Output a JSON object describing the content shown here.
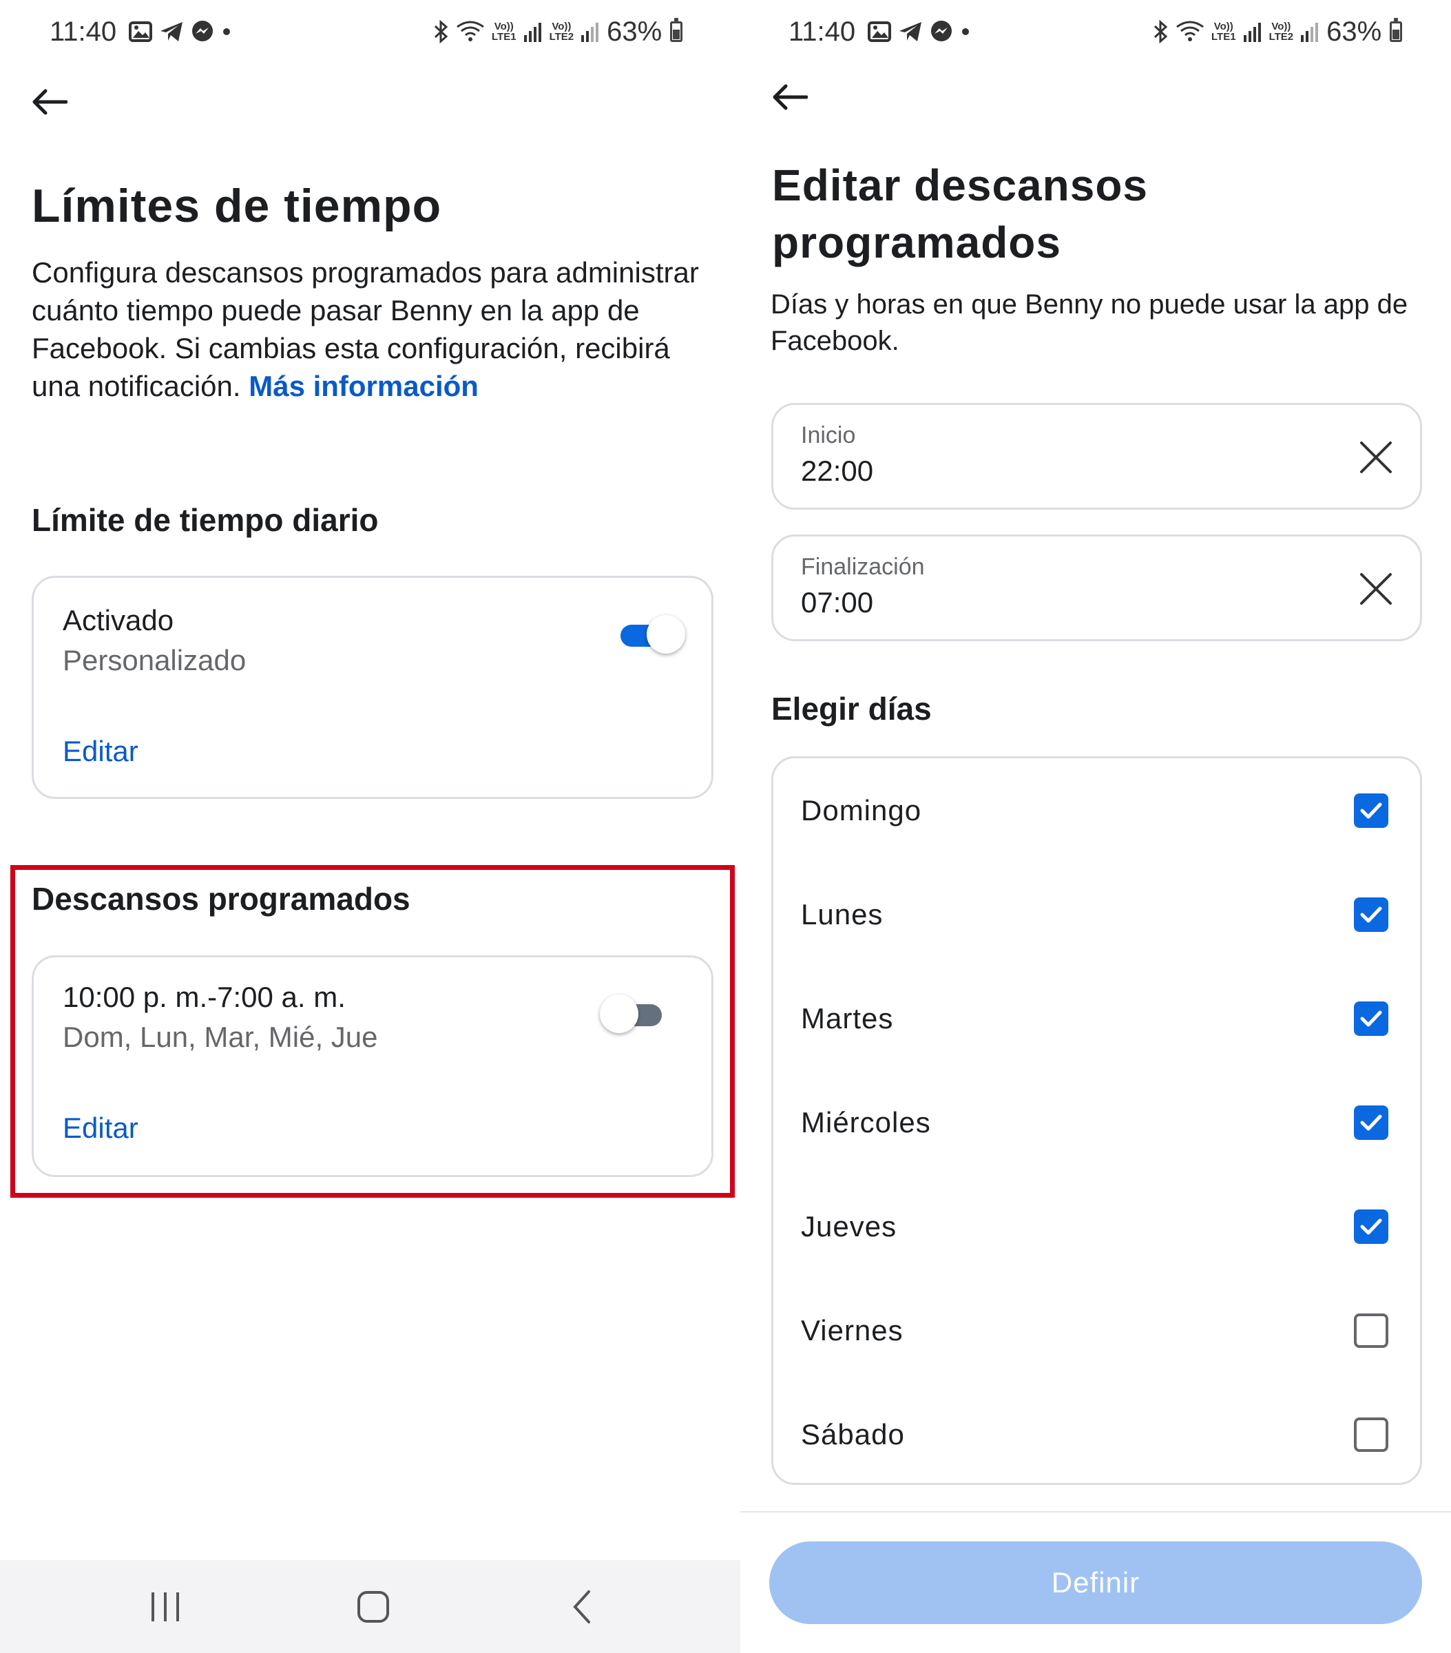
{
  "status_bar": {
    "time": "11:40",
    "battery": "63%",
    "net1": [
      "Vo))",
      "LTE1"
    ],
    "net2": [
      "Vo))",
      "LTE2"
    ],
    "icons": [
      "image-icon",
      "telegram-icon",
      "messenger-icon",
      "dot-icon",
      "bluetooth-icon",
      "wifi-icon",
      "signal-icon",
      "battery-icon"
    ]
  },
  "left": {
    "title": "Límites de tiempo",
    "description": "Configura descansos programados para administrar cuánto tiempo puede pasar Benny en la app de Facebook. Si cambias esta configuración, recibirá una notificación.",
    "more_info_link": "Más información",
    "daily_limit": {
      "heading": "Límite de tiempo diario",
      "status": "Activado",
      "mode": "Personalizado",
      "edit": "Editar",
      "enabled": true
    },
    "scheduled_breaks": {
      "heading": "Descansos programados",
      "range": "10:00 p. m.-7:00 a. m.",
      "days": "Dom, Lun, Mar, Mié, Jue",
      "edit": "Editar",
      "enabled": false
    }
  },
  "right": {
    "title_line1": "Editar descansos",
    "title_line2": "programados",
    "description": "Días y horas en que Benny no puede usar la app de Facebook.",
    "start": {
      "label": "Inicio",
      "value": "22:00"
    },
    "end": {
      "label": "Finalización",
      "value": "07:00"
    },
    "choose_days_heading": "Elegir días",
    "days": [
      {
        "label": "Domingo",
        "checked": true
      },
      {
        "label": "Lunes",
        "checked": true
      },
      {
        "label": "Martes",
        "checked": true
      },
      {
        "label": "Miércoles",
        "checked": true
      },
      {
        "label": "Jueves",
        "checked": true
      },
      {
        "label": "Viernes",
        "checked": false
      },
      {
        "label": "Sábado",
        "checked": false
      }
    ],
    "submit_button": "Definir"
  },
  "colors": {
    "accent": "#0a68e0",
    "link": "#0a5ac8",
    "highlight": "#d0021b",
    "button_disabled": "#9fc2f2"
  }
}
